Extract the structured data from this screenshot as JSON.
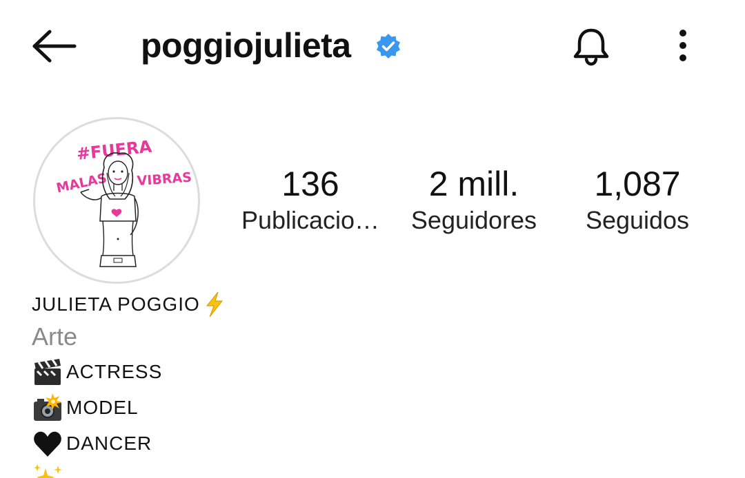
{
  "header": {
    "username": "poggiojulieta",
    "icons": {
      "back": "arrow-left-icon",
      "verified": "verified-badge-icon",
      "notifications": "bell-icon",
      "more": "more-vertical-icon"
    },
    "verified_color": "#3897f0"
  },
  "avatar": {
    "text_line1": "#FUERA",
    "text_line2": "MALAS",
    "text_line3": "VIBRAS",
    "accent_color": "#e6399b"
  },
  "stats": [
    {
      "value": "136",
      "label": "Publicacio…"
    },
    {
      "value": "2 mill.",
      "label": "Seguidores"
    },
    {
      "value": "1,087",
      "label": "Seguidos"
    }
  ],
  "bio": {
    "name": "JULIETA POGGIO",
    "name_emoji": "lightning-icon",
    "category": "Arte",
    "lines": [
      {
        "emoji": "clapper-board-icon",
        "text": "ACTRESS"
      },
      {
        "emoji": "camera-flash-icon",
        "text": "MODEL"
      },
      {
        "emoji": "black-heart-icon",
        "text": "DANCER"
      }
    ],
    "trailing_emoji": "sparkles-icon"
  }
}
